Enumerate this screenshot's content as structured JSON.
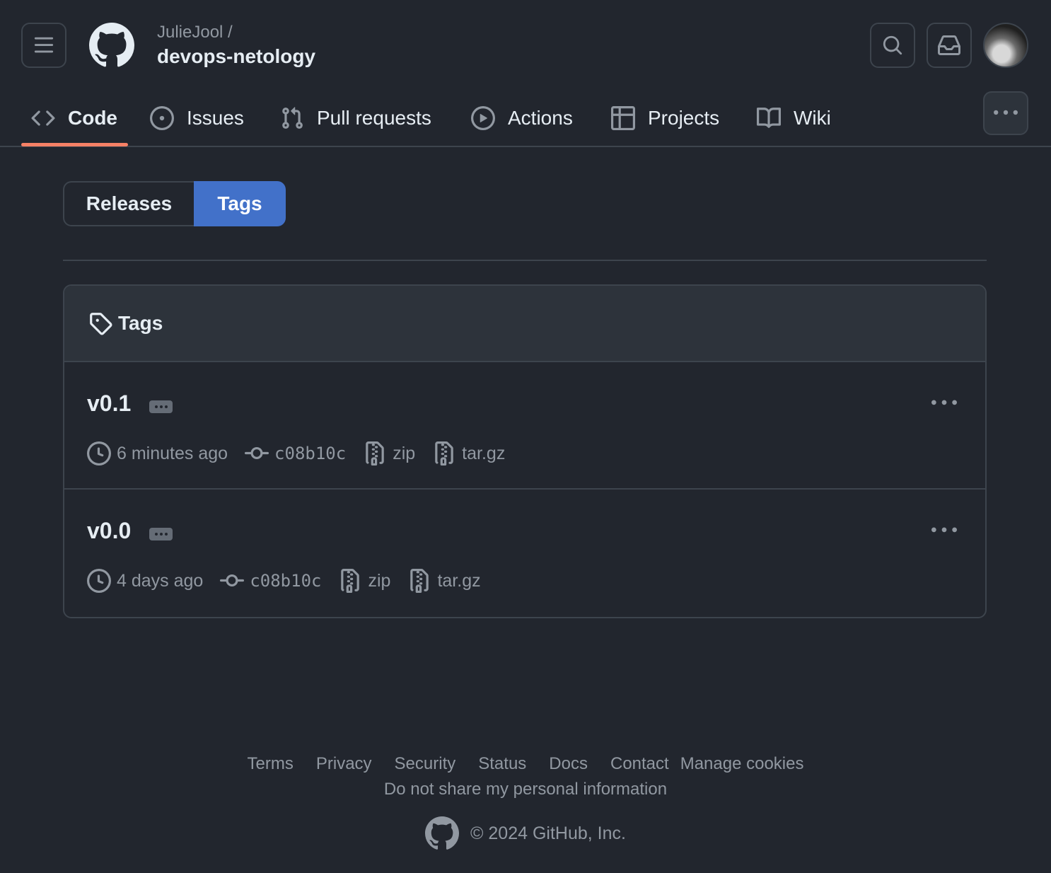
{
  "header": {
    "owner": "JulieJool /",
    "repo": "devops-netology"
  },
  "nav": {
    "code": "Code",
    "issues": "Issues",
    "pulls": "Pull requests",
    "actions": "Actions",
    "projects": "Projects",
    "wiki": "Wiki"
  },
  "segment": {
    "releases": "Releases",
    "tags": "Tags"
  },
  "tags_box": {
    "title": "Tags",
    "items": [
      {
        "name": "v0.1",
        "time": "6 minutes ago",
        "sha": "c08b10c",
        "zip": "zip",
        "targz": "tar.gz"
      },
      {
        "name": "v0.0",
        "time": "4 days ago",
        "sha": "c08b10c",
        "zip": "zip",
        "targz": "tar.gz"
      }
    ]
  },
  "footer": {
    "terms": "Terms",
    "privacy": "Privacy",
    "security": "Security",
    "status": "Status",
    "docs": "Docs",
    "contact": "Contact",
    "cookies": "Manage cookies",
    "no_share": "Do not share my personal information",
    "copyright": "© 2024 GitHub, Inc."
  },
  "colors": {
    "background": "#22262e",
    "accent_blue": "#4271c9",
    "nav_underline": "#f78166"
  }
}
